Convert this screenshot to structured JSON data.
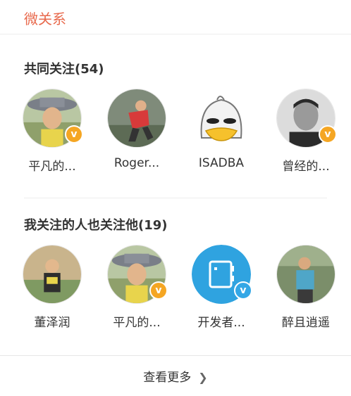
{
  "header": {
    "title": "微关系"
  },
  "sections": [
    {
      "title": "共同关注(54)",
      "users": [
        {
          "name": "平凡的...",
          "verified": true,
          "badge_color": "#f5a623"
        },
        {
          "name": "Roger...",
          "verified": false
        },
        {
          "name": "ISADBA",
          "verified": false
        },
        {
          "name": "曾经的...",
          "verified": true,
          "badge_color": "#f5a623"
        }
      ]
    },
    {
      "title": "我关注的人也关注他(19)",
      "users": [
        {
          "name": "董泽润",
          "verified": false
        },
        {
          "name": "平凡的...",
          "verified": true,
          "badge_color": "#f5a623"
        },
        {
          "name": "开发者...",
          "verified": true,
          "badge_color": "#34a7e6"
        },
        {
          "name": "醉且逍遥",
          "verified": false
        }
      ]
    }
  ],
  "footer": {
    "more_label": "查看更多",
    "chevron_icon": "chevron-right-icon"
  }
}
